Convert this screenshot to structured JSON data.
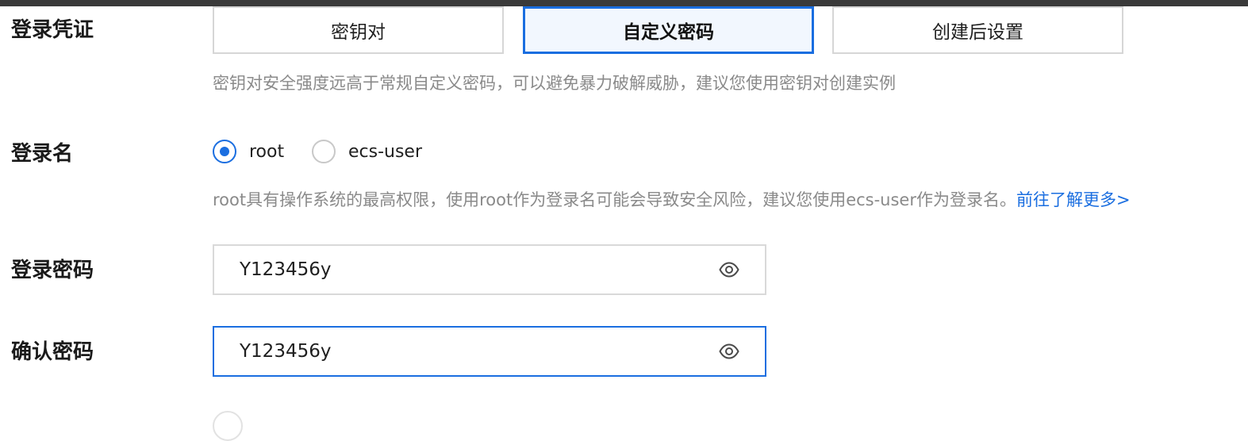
{
  "credentials": {
    "label": "登录凭证",
    "options": [
      {
        "label": "密钥对",
        "active": false
      },
      {
        "label": "自定义密码",
        "active": true
      },
      {
        "label": "创建后设置",
        "active": false
      }
    ],
    "help": "密钥对安全强度远高于常规自定义密码，可以避免暴力破解威胁，建议您使用密钥对创建实例"
  },
  "login_name": {
    "label": "登录名",
    "options": [
      {
        "label": "root",
        "checked": true
      },
      {
        "label": "ecs-user",
        "checked": false
      }
    ],
    "help": "root具有操作系统的最高权限，使用root作为登录名可能会导致安全风险，建议您使用ecs-user作为登录名。",
    "link": "前往了解更多>"
  },
  "password": {
    "label": "登录密码",
    "value": "Y123456y",
    "icon": "eye-icon"
  },
  "confirm_password": {
    "label": "确认密码",
    "value": "Y123456y",
    "icon": "eye-icon"
  },
  "colors": {
    "accent": "#1a6ee0",
    "help_text": "#8a8a8a",
    "border": "#d9d9d9"
  }
}
